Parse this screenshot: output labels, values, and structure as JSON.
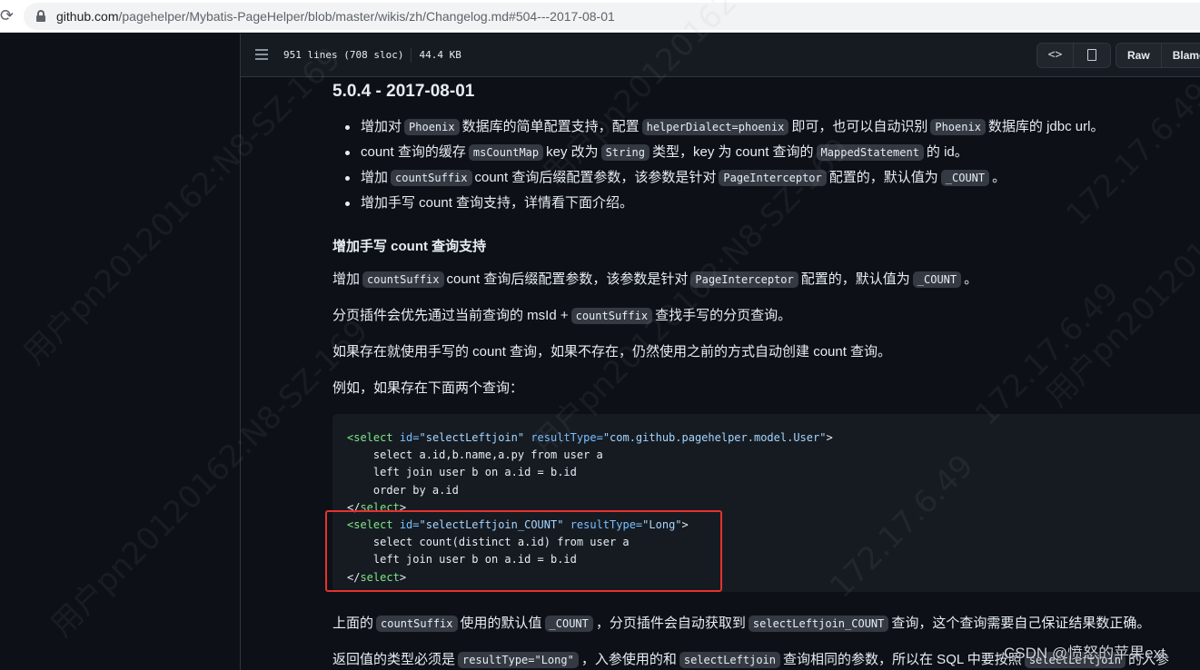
{
  "browser": {
    "url_host": "github.com",
    "url_path": "/pagehelper/Mybatis-PageHelper/blob/master/wikis/zh/Changelog.md#504---2017-08-01"
  },
  "file_header": {
    "lines": "951 lines (708 sloc)",
    "size": "44.4 KB",
    "raw_label": "Raw",
    "blame_label": "Blame"
  },
  "doc": {
    "heading": "5.0.4 - 2017-08-01",
    "bullets": [
      {
        "a": "增加对",
        "c1": "Phoenix",
        "b": "数据库的简单配置支持，配置",
        "c2": "helperDialect=phoenix",
        "d": "即可，也可以自动识别",
        "c3": "Phoenix",
        "e": "数据库的 jdbc url。"
      },
      {
        "a": "count 查询的缓存",
        "c1": "msCountMap",
        "b": "key 改为",
        "c2": "String",
        "d": "类型，key 为 count 查询的",
        "c3": "MappedStatement",
        "e": "的 id。"
      },
      {
        "a": "增加",
        "c1": "countSuffix",
        "b": "count 查询后缀配置参数，该参数是针对",
        "c2": "PageInterceptor",
        "d": "配置的，默认值为",
        "c3": "_COUNT",
        "e": "。"
      },
      {
        "a": "增加手写 count 查询支持，详情看下面介绍。"
      }
    ],
    "subheading": "增加手写 count 查询支持",
    "p1": {
      "a": "增加",
      "c1": "countSuffix",
      "b": "count 查询后缀配置参数，该参数是针对",
      "c2": "PageInterceptor",
      "d": "配置的，默认值为",
      "c3": "_COUNT",
      "e": "。"
    },
    "p2": {
      "a": "分页插件会优先通过当前查询的 msId +",
      "c1": "countSuffix",
      "b": "查找手写的分页查询。"
    },
    "p3": "如果存在就使用手写的 count 查询，如果不存在，仍然使用之前的方式自动创建 count 查询。",
    "p4": "例如，如果存在下面两个查询：",
    "code": {
      "l1_tag": "<select",
      "l1_a1": "id=",
      "l1_v1": "\"selectLeftjoin\"",
      "l1_a2": "resultType=",
      "l1_v2": "\"com.github.pagehelper.model.User\"",
      "l1_end": ">",
      "l2": "    select a.id,b.name,a.py from user a",
      "l3": "    left join user b on a.id = b.id",
      "l4": "    order by a.id",
      "l5_lt": "</",
      "l5_tag": "select",
      "l5_gt": ">",
      "l6_tag": "<select",
      "l6_a1": "id=",
      "l6_v1": "\"selectLeftjoin_COUNT\"",
      "l6_a2": "resultType=",
      "l6_v2": "\"Long\"",
      "l6_end": ">",
      "l7": "    select count(distinct a.id) from user a",
      "l8": "    left join user b on a.id = b.id",
      "l9_lt": "</",
      "l9_tag": "select",
      "l9_gt": ">"
    },
    "p5": {
      "a": "上面的",
      "c1": "countSuffix",
      "b": "使用的默认值",
      "c2": "_COUNT",
      "d": "，分页插件会自动获取到",
      "c3": "selectLeftjoin_COUNT",
      "e": "查询，这个查询需要自己保证结果数正确。"
    },
    "p6": {
      "a": "返回值的类型必须是",
      "c1": "resultType=\"Long\"",
      "b": "，入参使用的和",
      "c2": "selectLeftjoin",
      "d": "查询相同的参数，所以在 SQL 中要按照",
      "c3": "selectLeftjoin",
      "e": "的入参"
    }
  },
  "watermarks": [
    "用户pn20120162:N8-SZ-169",
    "172.17.6.49",
    "用户pn20120162:N8-SZ-169",
    "172.17.6.49",
    "用户pn20120162",
    "172.17.6.49",
    "用户pn20120162:N8-SZ-169",
    "用户pn201201"
  ],
  "csdn_watermark": "CSDN @愤怒的苹果ext"
}
